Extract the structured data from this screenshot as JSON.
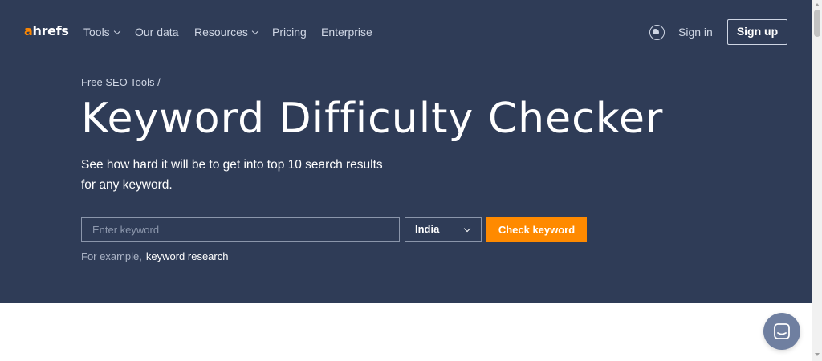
{
  "nav": {
    "logo_accent": "a",
    "logo_rest": "hrefs",
    "items": [
      {
        "label": "Tools",
        "dropdown": true
      },
      {
        "label": "Our data",
        "dropdown": false
      },
      {
        "label": "Resources",
        "dropdown": true
      },
      {
        "label": "Pricing",
        "dropdown": false
      },
      {
        "label": "Enterprise",
        "dropdown": false
      }
    ],
    "language_icon": "globe-icon",
    "signin_label": "Sign in",
    "signup_label": "Sign up"
  },
  "hero": {
    "breadcrumb": "Free SEO Tools /",
    "title": "Keyword Difficulty Checker",
    "subtitle": "See how hard it will be to get into top 10 search results for any keyword."
  },
  "search": {
    "keyword_value": "",
    "keyword_placeholder": "Enter keyword",
    "country_selected": "India",
    "submit_label": "Check keyword",
    "example_prefix": "For example,",
    "example_keyword": "keyword research"
  },
  "colors": {
    "hero_background": "#2f3c57",
    "accent_orange": "#ff8a00",
    "chat_button": "#6f7fa0"
  },
  "chat": {
    "icon": "chat-icon"
  }
}
